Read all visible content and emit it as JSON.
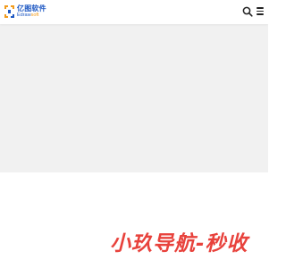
{
  "header": {
    "logo": {
      "name_cn": "亿图软件",
      "name_en_main": "Edraw",
      "name_en_accent": "soft",
      "brand_blue": "#1e58c3",
      "brand_orange": "#f29b1b"
    },
    "search_icon": "search-icon",
    "menu_icon": "menu-icon"
  },
  "banner": {
    "background": "#f1f1f1"
  },
  "hero": {
    "title": "小玖导航-秒收",
    "color": "#e8423c"
  }
}
